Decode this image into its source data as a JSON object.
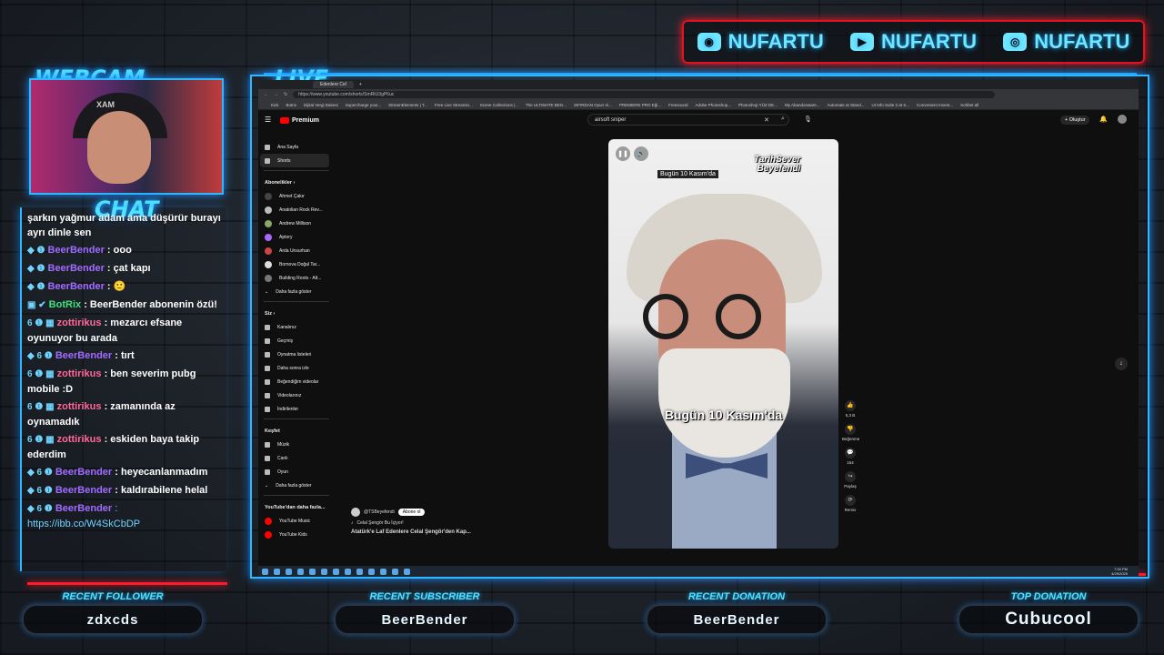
{
  "overlay": {
    "webcam_title": "WEBCAM",
    "live_title": "LIVE",
    "chat_title": "CHAT",
    "socials": [
      {
        "icon": "discord-icon",
        "name": "NUFARTU"
      },
      {
        "icon": "youtube-icon",
        "name": "NUFARTU"
      },
      {
        "icon": "instagram-icon",
        "name": "NUFARTU"
      }
    ],
    "webcam_chair_text": "XAM",
    "bottom": {
      "recent_follower_label": "RECENT FOLLOWER",
      "recent_follower": "zdxcds",
      "recent_subscriber_label": "RECENT SUBSCRIBER",
      "recent_subscriber": "BeerBender",
      "recent_donation_label": "RECENT DONATION",
      "recent_donation": "BeerBender",
      "top_donation_label": "TOP DONATION",
      "top_donation": "Cubucool"
    },
    "accent_blue": "#4fe3ff",
    "accent_red": "#ff1a2a"
  },
  "chat": [
    {
      "badges": "",
      "user": "",
      "text": "şarkın yağmur adam ama düşürür burayı ayrı dinle sen",
      "color": "purple"
    },
    {
      "badges": "◆ ❶",
      "user": "BeerBender",
      "text": ": ooo",
      "color": "purple"
    },
    {
      "badges": "◆ ❶",
      "user": "BeerBender",
      "text": ": çat kapı",
      "color": "purple"
    },
    {
      "badges": "◆ ❶",
      "user": "BeerBender",
      "text": ": 🙂",
      "color": "purple"
    },
    {
      "badges": "▣ ✔",
      "user": "BotRix",
      "text": ": BeerBender abonenin özü!",
      "color": "green"
    },
    {
      "badges": "6 ❶ ▦",
      "user": "zottirikus",
      "text": ": mezarcı efsane oyunuyor bu arada",
      "color": "pink"
    },
    {
      "badges": "◆ 6 ❶",
      "user": "BeerBender",
      "text": ": tırt",
      "color": "purple"
    },
    {
      "badges": "6 ❶ ▦",
      "user": "zottirikus",
      "text": ": ben severim pubg mobile :D",
      "color": "pink"
    },
    {
      "badges": "6 ❶ ▦",
      "user": "zottirikus",
      "text": ": zamanında az oynamadık",
      "color": "pink"
    },
    {
      "badges": "6 ❶ ▦",
      "user": "zottirikus",
      "text": ": eskiden baya takip ederdim",
      "color": "pink"
    },
    {
      "badges": "◆ 6 ❶",
      "user": "BeerBender",
      "text": ": heyecanlanmadım",
      "color": "purple"
    },
    {
      "badges": "◆ 6 ❶",
      "user": "BeerBender",
      "text": ": kaldırabilene helal",
      "color": "purple"
    },
    {
      "badges": "◆ 6 ❶",
      "user": "BeerBender",
      "text": ": https://ibb.co/W4SkCbDP",
      "color": "purple"
    }
  ],
  "browser": {
    "tab_title": "Edenlere Cel",
    "url": "https://www.youtube.com/shorts/SmRtU3gP6uc",
    "bookmarks": [
      "Kick",
      "Botrix",
      "Dijital Vergi Dairesi",
      "Supercharge your...",
      "StreamElements | T...",
      "Free Live Streamin...",
      "Scene Collections |...",
      "The ULTIMATE BEG...",
      "SIFIRDAN Oyun Vi...",
      "PREMIERE PRO Eği...",
      "Freesound",
      "Adobe Photoshop...",
      "Photoshop YÜZ DE...",
      "My Abandonware...",
      "Automate at Stand...",
      "UI Info Suite 2 at S...",
      "Convenient Invent..."
    ],
    "right_bookmark": "Sohbet all"
  },
  "youtube": {
    "logo": "Premium",
    "search_value": "airsoft sniper",
    "create_label": "Oluştur",
    "sidebar": {
      "main": [
        {
          "label": "Ana Sayfa",
          "icon": "home-icon"
        },
        {
          "label": "Shorts",
          "icon": "shorts-icon",
          "active": true
        }
      ],
      "subs_header": "Abonelikler",
      "subs": [
        "Ahmet Çakır",
        "Anatolian Rock Rev...",
        "Andrew Millison",
        "Aptory",
        "Arda Unsurhan",
        "Bornova Doğal Tar...",
        "Building Roots - Alt..."
      ],
      "show_more": "Daha fazla göster",
      "you_header": "Siz",
      "you": [
        "Kanalınız",
        "Geçmiş",
        "Oynatma listeleri",
        "Daha sonra izle",
        "Beğendiğim videolar",
        "Videolarınız",
        "İndirilenler"
      ],
      "explore_header": "Keşfet",
      "explore": [
        "Müzik",
        "Canlı",
        "Oyun"
      ],
      "explore_more": "Daha fazla göster",
      "more_header": "YouTube'dan daha fazla...",
      "more": [
        "YouTube Music",
        "YouTube Kids"
      ]
    },
    "short": {
      "top_caption": "Bugün 10 Kasım'da",
      "watermark_line1": "TarihSever",
      "watermark_line2": "Beyefendi",
      "mid_caption": "Bugün 10 Kasım'da",
      "channel": "@TSBeyefendi",
      "subscribe": "Abone ol",
      "music": "Celal Şengör Bu İçiyor!",
      "title": "Atatürk'e Laf Edenlere Celal Şengör'den Kap..."
    },
    "actions": [
      {
        "icon": "like-icon",
        "label": "5,3 B"
      },
      {
        "icon": "dislike-icon",
        "label": "Beğenme"
      },
      {
        "icon": "comment-icon",
        "label": "154"
      },
      {
        "icon": "share-icon",
        "label": "Paylaş"
      },
      {
        "icon": "remix-icon",
        "label": "Remix"
      }
    ],
    "clock_time": "7:30 PM",
    "clock_date": "4/29/2025"
  }
}
